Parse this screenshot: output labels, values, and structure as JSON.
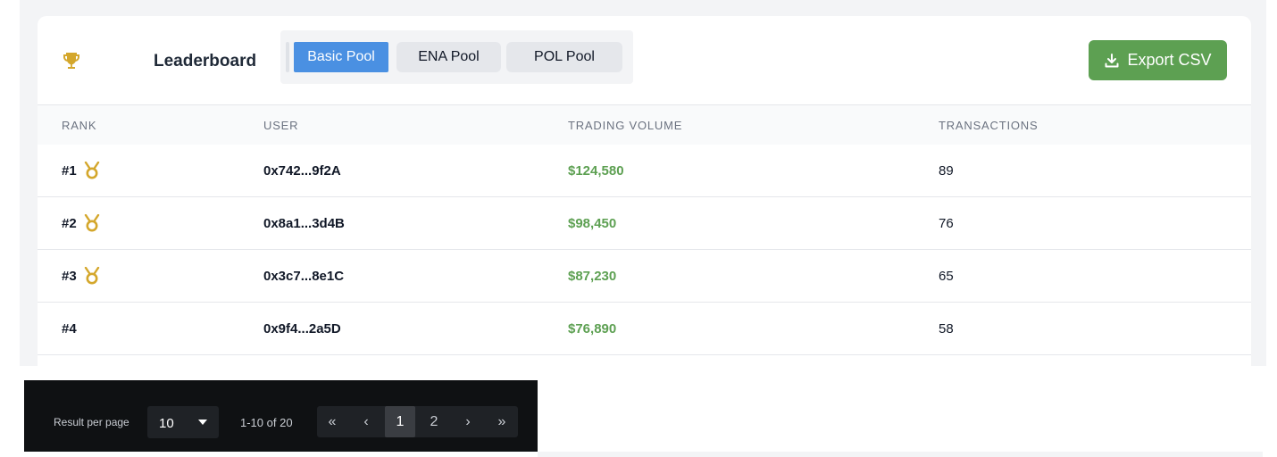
{
  "header": {
    "title": "Leaderboard",
    "tabs": [
      {
        "label": "Basic Pool",
        "active": true
      },
      {
        "label": "ENA Pool",
        "active": false
      },
      {
        "label": "POL Pool",
        "active": false
      }
    ],
    "export_label": "Export CSV"
  },
  "table": {
    "columns": [
      "RANK",
      "USER",
      "TRADING VOLUME",
      "TRANSACTIONS"
    ],
    "rows": [
      {
        "rank": "#1",
        "medal": true,
        "user": "0x742...9f2A",
        "volume": "$124,580",
        "transactions": "89"
      },
      {
        "rank": "#2",
        "medal": true,
        "user": "0x8a1...3d4B",
        "volume": "$98,450",
        "transactions": "76"
      },
      {
        "rank": "#3",
        "medal": true,
        "user": "0x3c7...8e1C",
        "volume": "$87,230",
        "transactions": "65"
      },
      {
        "rank": "#4",
        "medal": false,
        "user": "0x9f4...2a5D",
        "volume": "$76,890",
        "transactions": "58"
      }
    ]
  },
  "pagination": {
    "per_page_label": "Result per page",
    "per_page_value": "10",
    "range": "1-10 of 20",
    "first": "«",
    "prev": "‹",
    "pages": [
      "1",
      "2"
    ],
    "current_page": "1",
    "next": "›",
    "last": "»"
  },
  "colors": {
    "accent_blue": "#4a90e2",
    "export_green": "#5da052",
    "volume_green": "#5da052",
    "trophy_gold": "#d4a72c",
    "pager_bg": "#0f1113"
  },
  "icons": {
    "trophy": "trophy-icon",
    "medal": "medal-icon",
    "download": "download-icon",
    "caret": "caret-down-icon"
  }
}
